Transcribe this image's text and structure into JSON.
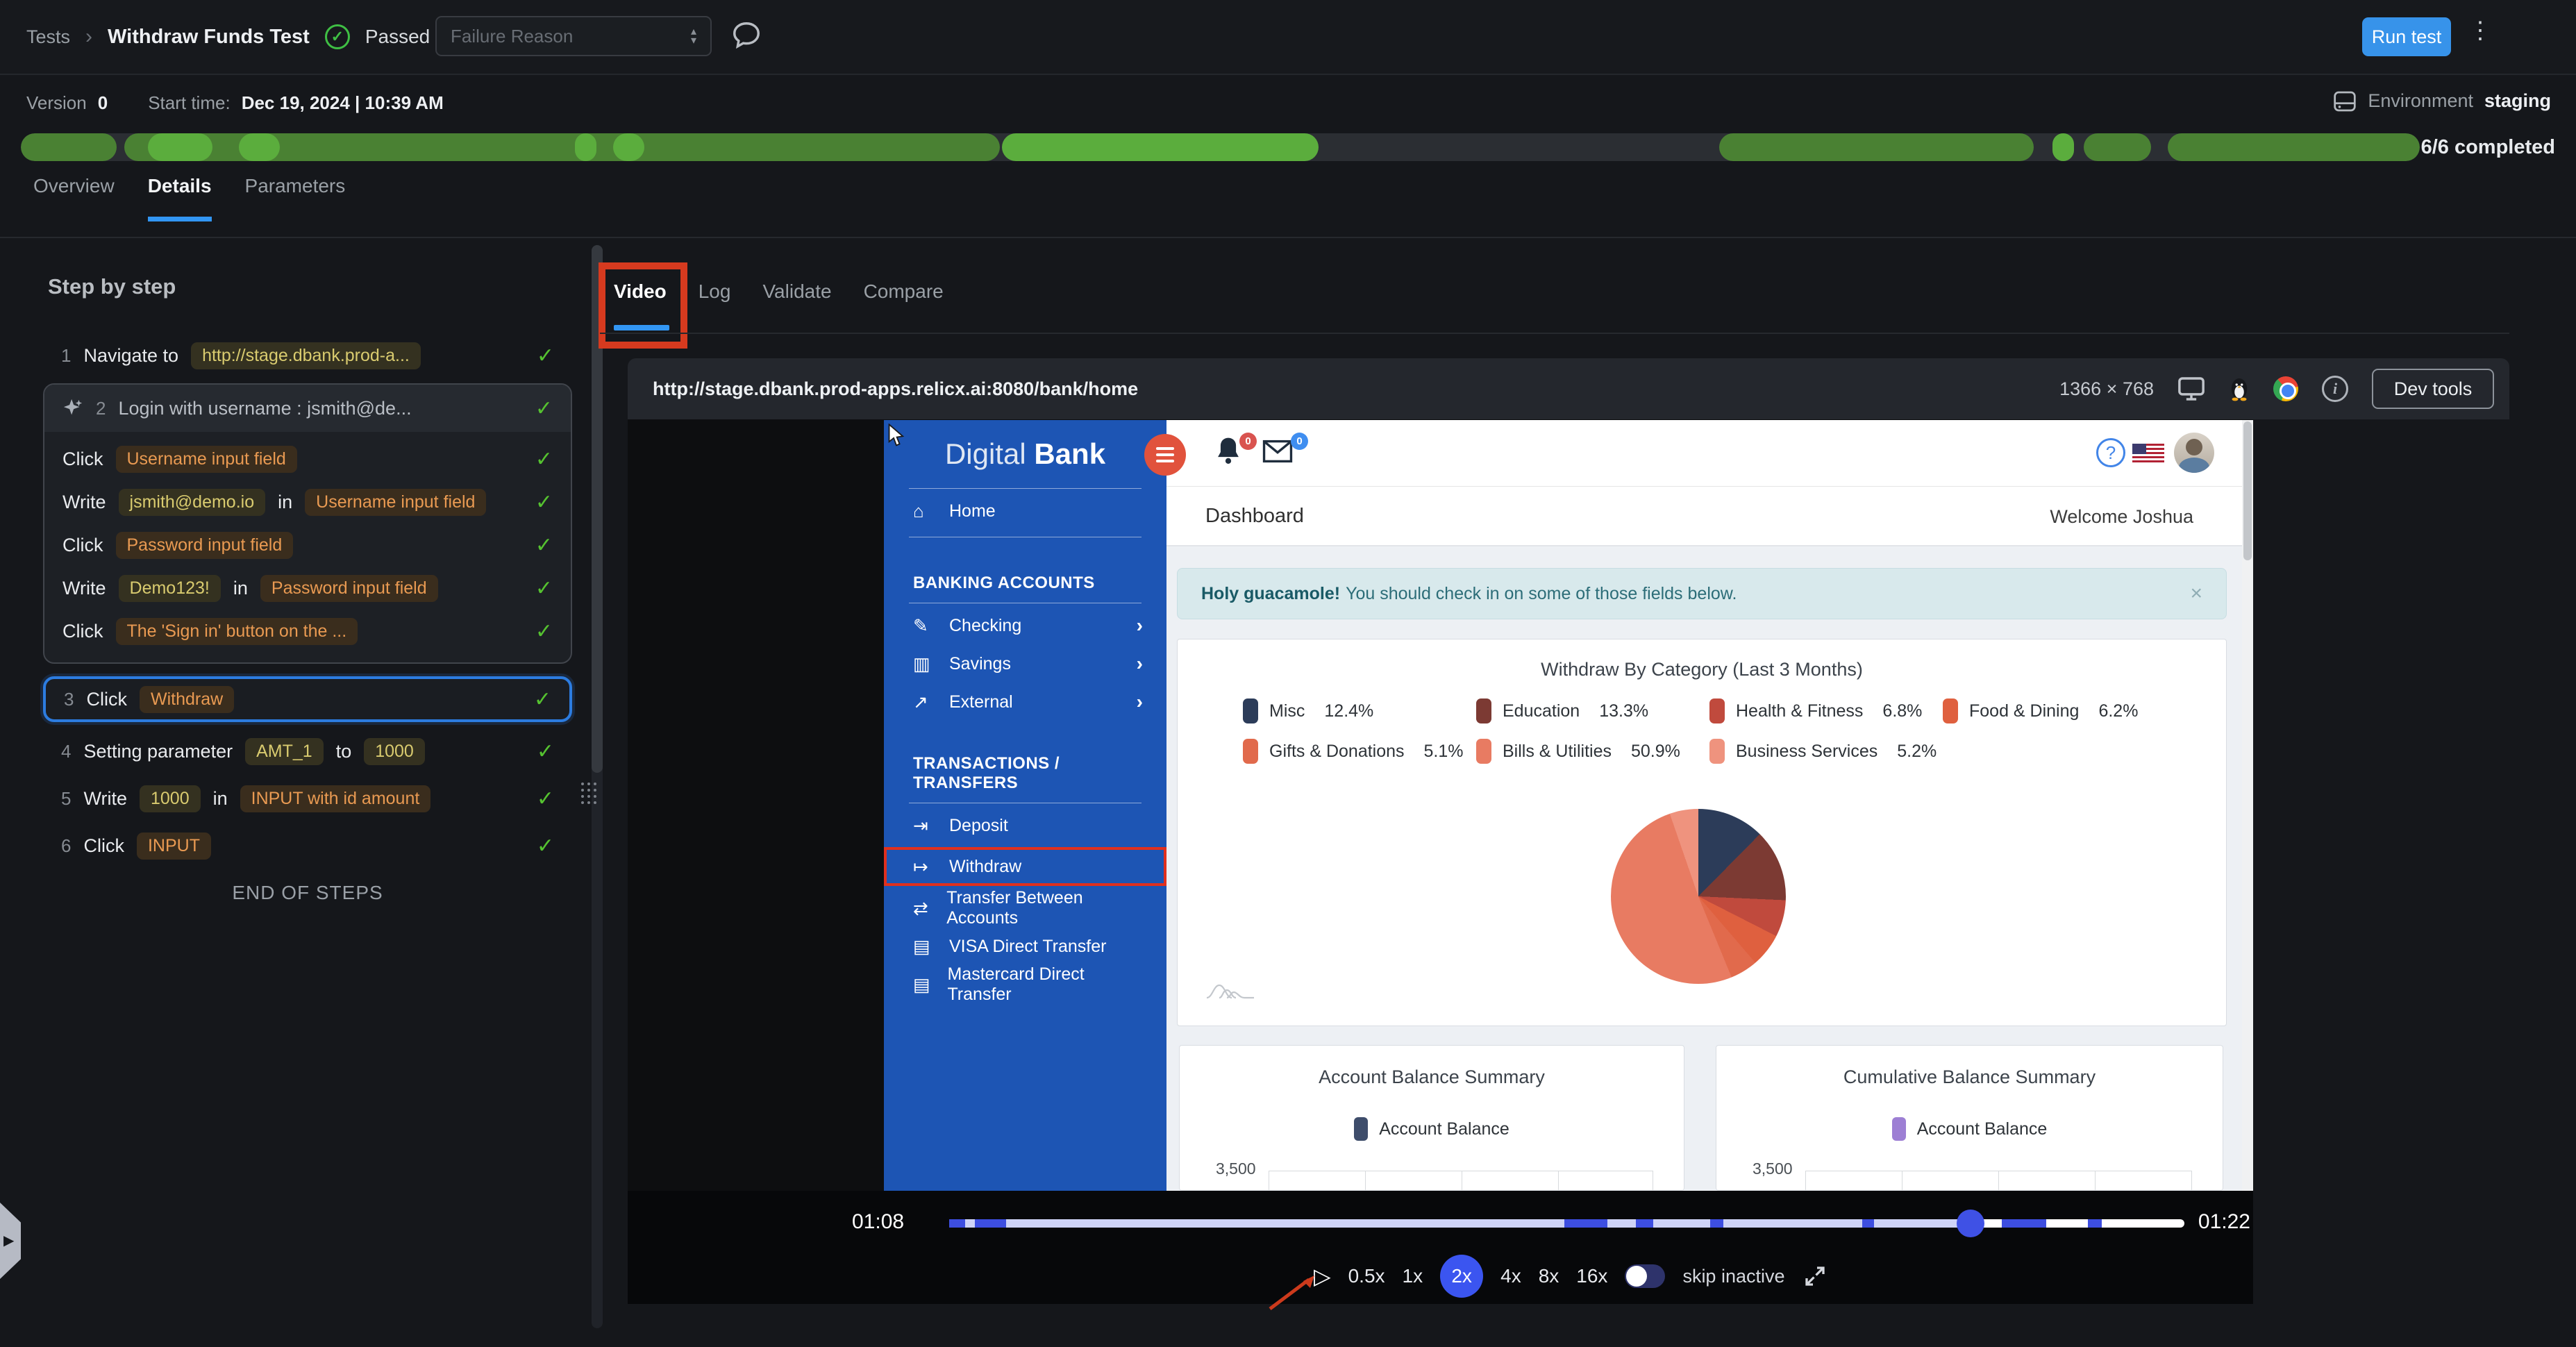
{
  "header": {
    "breadcrumb": {
      "root": "Tests",
      "separator": "›",
      "title": "Withdraw Funds Test"
    },
    "status": {
      "label": "Passed"
    },
    "failure_reason": {
      "placeholder": "Failure Reason"
    },
    "run_test_label": "Run test",
    "meta": {
      "version_label": "Version",
      "version_value": "0",
      "start_label": "Start time:",
      "start_value": "Dec 19, 2024 | 10:39 AM",
      "environment_label": "Environment",
      "environment_value": "staging",
      "completed": "6/6 completed"
    },
    "progress_segments": [
      {
        "l": 0,
        "w": 4.0,
        "tone": "mid"
      },
      {
        "l": 4.3,
        "w": 36.5,
        "tone": "mid"
      },
      {
        "l": 5.3,
        "w": 2.7,
        "tone": "hi"
      },
      {
        "l": 9.1,
        "w": 1.7,
        "tone": "hi"
      },
      {
        "l": 23.1,
        "w": 0.9,
        "tone": "hi"
      },
      {
        "l": 24.7,
        "w": 1.3,
        "tone": "hi"
      },
      {
        "l": 40.9,
        "w": 13.2,
        "tone": "hi"
      },
      {
        "l": 70.8,
        "w": 13.1,
        "tone": "mid"
      },
      {
        "l": 84.7,
        "w": 0.9,
        "tone": "hi"
      },
      {
        "l": 86.0,
        "w": 2.8,
        "tone": "mid"
      },
      {
        "l": 89.5,
        "w": 10.5,
        "tone": "mid"
      }
    ]
  },
  "main_tabs": [
    {
      "label": "Overview",
      "active": false
    },
    {
      "label": "Details",
      "active": true
    },
    {
      "label": "Parameters",
      "active": false
    }
  ],
  "steps_panel": {
    "heading": "Step by step",
    "end_label": "END OF STEPS",
    "rows": [
      {
        "type": "step",
        "num": "1",
        "check": true,
        "tokens": [
          {
            "t": "text",
            "v": "Navigate to"
          },
          {
            "t": "code",
            "v": "http://stage.dbank.prod-a..."
          }
        ]
      },
      {
        "type": "group",
        "num": "2",
        "check": true,
        "label": "Login with username : jsmith@de...",
        "children": [
          {
            "check": true,
            "tokens": [
              {
                "t": "text",
                "v": "Click"
              },
              {
                "t": "ref",
                "v": "Username input field"
              }
            ]
          },
          {
            "check": true,
            "tokens": [
              {
                "t": "text",
                "v": "Write"
              },
              {
                "t": "code",
                "v": "jsmith@demo.io"
              },
              {
                "t": "text",
                "v": "in"
              },
              {
                "t": "ref",
                "v": "Username input field"
              }
            ]
          },
          {
            "check": true,
            "tokens": [
              {
                "t": "text",
                "v": "Click"
              },
              {
                "t": "ref",
                "v": "Password input field"
              }
            ]
          },
          {
            "check": true,
            "tokens": [
              {
                "t": "text",
                "v": "Write"
              },
              {
                "t": "code",
                "v": "Demo123!"
              },
              {
                "t": "text",
                "v": "in"
              },
              {
                "t": "ref",
                "v": "Password input field"
              }
            ]
          },
          {
            "check": true,
            "tokens": [
              {
                "t": "text",
                "v": "Click"
              },
              {
                "t": "ref",
                "v": "The 'Sign in' button on the ..."
              }
            ]
          }
        ]
      },
      {
        "type": "step",
        "num": "3",
        "selected": true,
        "check": true,
        "tokens": [
          {
            "t": "text",
            "v": "Click"
          },
          {
            "t": "ref",
            "v": "Withdraw"
          }
        ]
      },
      {
        "type": "step",
        "num": "4",
        "check": true,
        "tokens": [
          {
            "t": "text",
            "v": "Setting parameter"
          },
          {
            "t": "code",
            "v": "AMT_1"
          },
          {
            "t": "text",
            "v": "to"
          },
          {
            "t": "code",
            "v": "1000"
          }
        ]
      },
      {
        "type": "step",
        "num": "5",
        "check": true,
        "tokens": [
          {
            "t": "text",
            "v": "Write"
          },
          {
            "t": "code",
            "v": "1000"
          },
          {
            "t": "text",
            "v": "in"
          },
          {
            "t": "ref",
            "v": "INPUT with id amount"
          }
        ]
      },
      {
        "type": "step",
        "num": "6",
        "check": true,
        "tokens": [
          {
            "t": "text",
            "v": "Click"
          },
          {
            "t": "ref",
            "v": "INPUT"
          }
        ]
      }
    ]
  },
  "video_panel": {
    "tabs": [
      {
        "label": "Video",
        "active": true
      },
      {
        "label": "Log",
        "active": false
      },
      {
        "label": "Validate",
        "active": false
      },
      {
        "label": "Compare",
        "active": false
      }
    ],
    "url": "http://stage.dbank.prod-apps.relicx.ai:8080/bank/home",
    "resolution": "1366 × 768",
    "devtools_label": "Dev tools",
    "player": {
      "time_current": "01:08",
      "time_total": "01:22",
      "progress_pct": 82.7,
      "markers": [
        {
          "l": 0,
          "w": 1.3
        },
        {
          "l": 2.1,
          "w": 2.5
        },
        {
          "l": 49.8,
          "w": 3.5
        },
        {
          "l": 55.6,
          "w": 1.4
        },
        {
          "l": 61.6,
          "w": 1.1
        },
        {
          "l": 73.9,
          "w": 1.0
        },
        {
          "l": 85.2,
          "w": 3.6
        },
        {
          "l": 92.2,
          "w": 1.1
        }
      ],
      "speeds": [
        "0.5x",
        "1x",
        "2x",
        "4x",
        "8x",
        "16x"
      ],
      "active_speed": "2x",
      "skip_inactive_label": "skip inactive"
    }
  },
  "bank_app": {
    "logo": {
      "light": "Digital",
      "bold": "Bank"
    },
    "nav": [
      {
        "items": [
          {
            "icon": "home",
            "label": "Home"
          }
        ]
      },
      {
        "header": "BANKING ACCOUNTS",
        "items": [
          {
            "icon": "pencil",
            "label": "Checking",
            "chevron": "›"
          },
          {
            "icon": "cash",
            "label": "Savings",
            "chevron": "›"
          },
          {
            "icon": "external",
            "label": "External",
            "chevron": "›"
          }
        ]
      },
      {
        "header": "TRANSACTIONS / TRANSFERS",
        "items": [
          {
            "icon": "deposit",
            "label": "Deposit"
          },
          {
            "icon": "withdraw",
            "label": "Withdraw",
            "highlighted": true
          },
          {
            "icon": "shuffle",
            "label": "Transfer Between Accounts"
          },
          {
            "icon": "card",
            "label": "VISA Direct Transfer"
          },
          {
            "icon": "card",
            "label": "Mastercard Direct Transfer"
          }
        ]
      }
    ],
    "topbar": {
      "notifications_badge": "0",
      "messages_badge": "0"
    },
    "page_title": "Dashboard",
    "welcome": "Welcome Joshua",
    "alert": {
      "bold": "Holy guacamole!",
      "text": "You should check in on some of those fields below.",
      "close": "×"
    },
    "summary_cards": [
      {
        "title": "Account Balance Summary",
        "legend": "Account Balance",
        "axis_max": "3,500",
        "color": "#3e4d6b"
      },
      {
        "title": "Cumulative Balance Summary",
        "legend": "Account Balance",
        "axis_max": "3,500",
        "color": "#9d7fd4"
      }
    ]
  },
  "chart_data": [
    {
      "type": "pie",
      "title": "Withdraw By Category (Last 3 Months)",
      "legend_position": "top",
      "segments": [
        {
          "label": "Misc",
          "value": 12.4,
          "color": "#2c3c59"
        },
        {
          "label": "Education",
          "value": 13.3,
          "color": "#7c3a33"
        },
        {
          "label": "Health & Fitness",
          "value": 6.8,
          "color": "#c04a3d"
        },
        {
          "label": "Food & Dining",
          "value": 6.2,
          "color": "#df603f"
        },
        {
          "label": "Gifts & Donations",
          "value": 5.1,
          "color": "#e16a4c"
        },
        {
          "label": "Bills & Utilities",
          "value": 50.9,
          "color": "#e87b62"
        },
        {
          "label": "Business Services",
          "value": 5.2,
          "color": "#ef937e"
        }
      ]
    },
    {
      "type": "bar",
      "title": "Account Balance Summary",
      "series": [
        {
          "name": "Account Balance",
          "color": "#3e4d6b"
        }
      ],
      "ylim": [
        0,
        3500
      ],
      "ytick_labels": [
        "3,500"
      ],
      "note": "chart body cropped by video frame"
    },
    {
      "type": "bar",
      "title": "Cumulative Balance Summary",
      "series": [
        {
          "name": "Account Balance",
          "color": "#9d7fd4"
        }
      ],
      "ylim": [
        0,
        3500
      ],
      "ytick_labels": [
        "3,500"
      ],
      "note": "chart body cropped by video frame"
    }
  ]
}
